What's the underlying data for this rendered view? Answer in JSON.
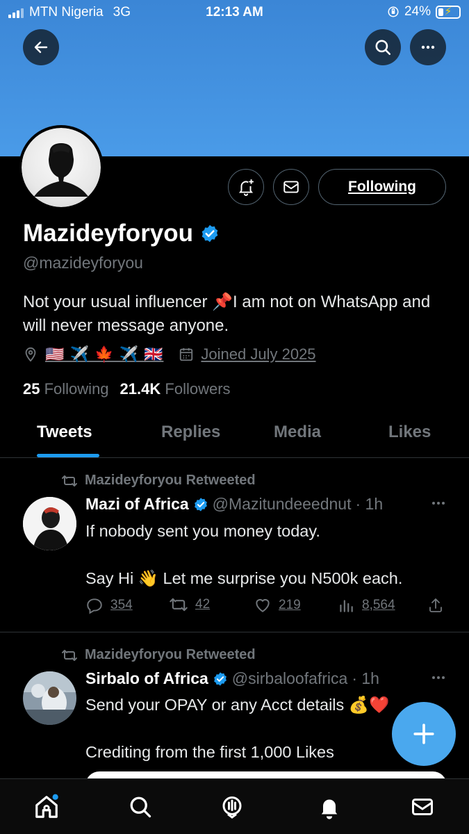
{
  "status_bar": {
    "carrier": "MTN Nigeria",
    "network": "3G",
    "time": "12:13 AM",
    "battery": "24%",
    "battery_level": 0.24
  },
  "header": {
    "back_icon": "arrow-left-icon",
    "search_icon": "search-icon",
    "more_icon": "more-horizontal-icon",
    "banner_color": "#4a9be8"
  },
  "profile": {
    "display_name": "Mazideyforyou",
    "verified": true,
    "handle": "@mazideyforyou",
    "bio": "Not your usual influencer 📌I am not on WhatsApp and will never message anyone.",
    "location": "🇺🇸 ✈️ 🍁 ✈️ 🇬🇧",
    "joined": "Joined July 2025",
    "following_count": "25",
    "following_label": "Following",
    "followers_count": "21.4K",
    "followers_label": "Followers",
    "follow_button": "Following"
  },
  "tabs": [
    {
      "label": "Tweets",
      "active": true
    },
    {
      "label": "Replies",
      "active": false
    },
    {
      "label": "Media",
      "active": false
    },
    {
      "label": "Likes",
      "active": false
    }
  ],
  "tweets": [
    {
      "retweeted_by": "Mazideyforyou Retweeted",
      "name": "Mazi of Africa",
      "handle": "@Mazitundeeednut",
      "time": "· 1h",
      "text": "If nobody sent you money today.\n\nSay Hi 👋 Let me surprise you N500k each.",
      "replies": "354",
      "retweets": "42",
      "likes": "219",
      "views": "8,564"
    },
    {
      "retweeted_by": "Mazideyforyou Retweeted",
      "name": "Sirbalo of Africa",
      "handle": "@sirbaloofafrica",
      "time": "· 1h",
      "text": "Send your OPAY or any Acct details 💰❤️\n\nCrediting from the first 1,000 Likes"
    }
  ],
  "colors": {
    "accent": "#1d9bf0",
    "fab": "#4aa8ee",
    "secondary_text": "#71767b"
  },
  "nav": [
    "home-icon",
    "search-icon",
    "spaces-icon",
    "notifications-icon",
    "messages-icon"
  ]
}
